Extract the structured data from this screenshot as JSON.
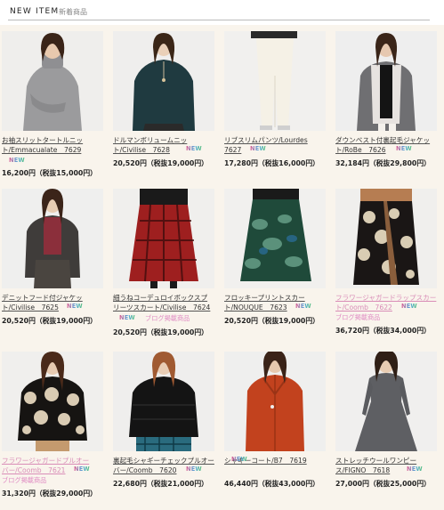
{
  "header": {
    "title": "NEW ITEM",
    "subtitle": "新着商品"
  },
  "new_label": "NEW",
  "blog_label": "ブログ掲載商品",
  "items": [
    {
      "name_line1": "お袖スリットタートルニッ",
      "name_line2": "ト/Emmacualate　7629",
      "price": "16,200円（税抜15,000円）"
    },
    {
      "name_line1": "ドルマンボリュームニッ",
      "name_line2": "ト/Civilise　7628",
      "price": "20,520円（税抜19,000円）"
    },
    {
      "name_line1": "リブスリムパンツ/Lourdes",
      "name_line2": "7627",
      "price": "17,280円（税抜16,000円）"
    },
    {
      "name_line1": "ダウンベスト付裏起毛ジャケッ",
      "name_line2": "ト/RoBe　7626",
      "price": "32,184円（税抜29,800円）"
    },
    {
      "name_line1": "デニットフード付ジャケッ",
      "name_line2": "ト/Civilise　7625",
      "price": "20,520円（税抜19,000円）"
    },
    {
      "name_line1": "細うねコーデュロイボックスプ",
      "name_line2": "リーツスカート/Civilise　7624",
      "price": "20,520円（税抜19,000円）"
    },
    {
      "name_line1": "フロッキープリントスカー",
      "name_line2": "ト/NOUQUE　7623",
      "price": "20,520円（税抜19,000円）"
    },
    {
      "name_line1": "フラワージャガードラップスカー",
      "name_line2": "ト/Coomb　7622",
      "price": "36,720円（税抜34,000円）"
    },
    {
      "name_line1": "フラワージャガードプルオー",
      "name_line2": "バー/Coomb　7621",
      "price": "31,320円（税抜29,000円）"
    },
    {
      "name_line1": "裏起毛シャギーチェックプルオー",
      "name_line2": "バー/Coomb　7620",
      "price": "22,680円（税抜21,000円）"
    },
    {
      "name_line1": "シャギーコート/B7　7619",
      "name_line2": "",
      "price": "46,440円（税抜43,000円）"
    },
    {
      "name_line1": "ストレッチウールワンピー",
      "name_line2": "ス/FIGNO　7618",
      "price": "27,000円（税抜25,000円）"
    }
  ]
}
